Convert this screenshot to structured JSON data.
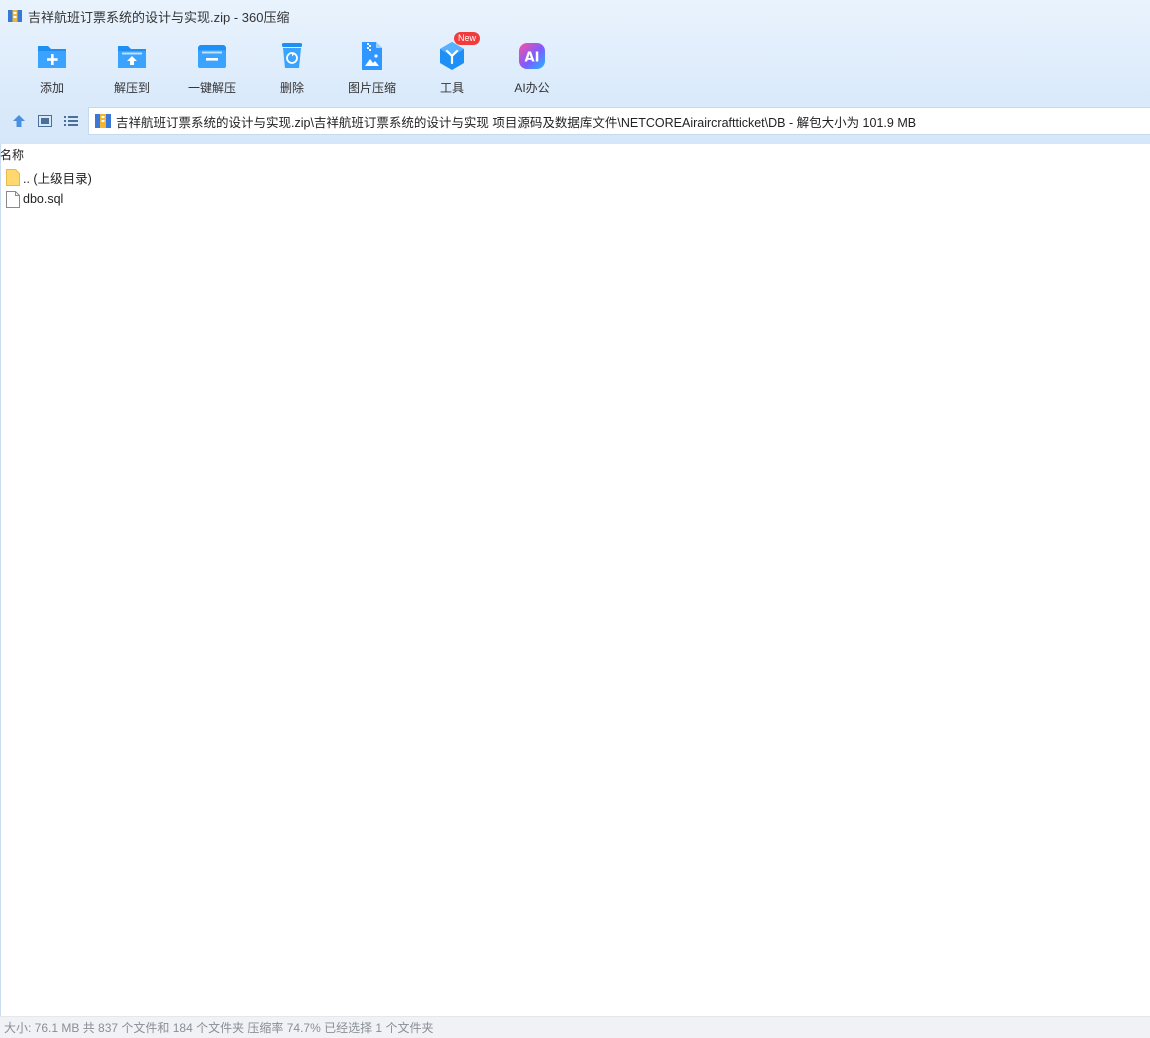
{
  "window": {
    "title": "吉祥航班订票系统的设计与实现.zip - 360压缩"
  },
  "toolbar": {
    "items": [
      {
        "label": "添加",
        "icon": "add-folder-icon"
      },
      {
        "label": "解压到",
        "icon": "extract-to-icon"
      },
      {
        "label": "一键解压",
        "icon": "one-click-extract-icon"
      },
      {
        "label": "删除",
        "icon": "recycle-bin-icon"
      },
      {
        "label": "图片压缩",
        "icon": "image-compress-icon"
      },
      {
        "label": "工具",
        "icon": "tools-icon",
        "badge": "New"
      },
      {
        "label": "AI办公",
        "icon": "ai-office-icon"
      }
    ]
  },
  "address": {
    "path": "吉祥航班订票系统的设计与实现.zip\\吉祥航班订票系统的设计与实现 项目源码及数据库文件\\NETCOREAiraircraftticket\\DB - 解包大小为 101.9 MB"
  },
  "list": {
    "column_name": "名称",
    "rows": [
      {
        "name": ".. (上级目录)",
        "type": "folder"
      },
      {
        "name": "dbo.sql",
        "type": "file"
      }
    ]
  },
  "status": {
    "text": "大小: 76.1 MB 共 837 个文件和 184 个文件夹 压缩率 74.7% 已经选择 1 个文件夹"
  },
  "colors": {
    "accent": "#1e90ff",
    "header_bg": "#dcebfb",
    "badge": "#f23b3b"
  }
}
